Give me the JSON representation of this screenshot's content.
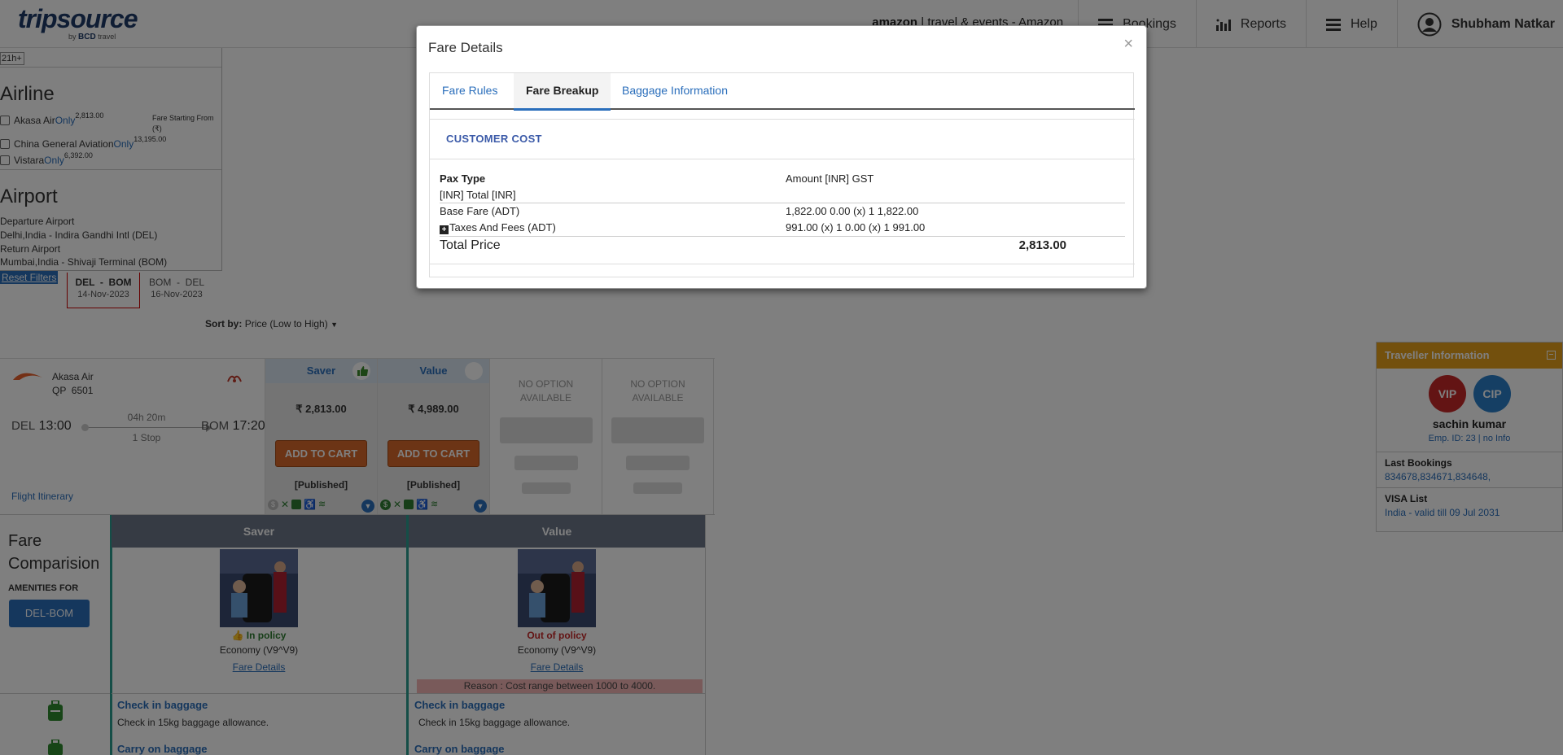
{
  "header": {
    "logo_main": "tripsource",
    "logo_sub_by": "by",
    "logo_sub_brand": "BCD",
    "logo_sub_tail": "travel",
    "account_bold": "amazon",
    "account_rest": " | travel & events - Amazon",
    "nav": [
      {
        "label": "Bookings",
        "icon": "bookings-icon"
      },
      {
        "label": "Reports",
        "icon": "reports-icon"
      },
      {
        "label": "Help",
        "icon": "help-icon"
      }
    ],
    "user_name": "Shubham Natkar"
  },
  "filters": {
    "time_chip": "21h+",
    "airline_heading": "Airline",
    "fare_starting_label": "Fare Starting From (₹)",
    "airlines": [
      {
        "name": "Akasa Air",
        "only": "Only",
        "price": "2,813.00"
      },
      {
        "name": "China General Aviation",
        "only": "Only",
        "price": "13,195.00"
      },
      {
        "name": "Vistara",
        "only": "Only",
        "price": "6,392.00"
      }
    ],
    "airport_heading": "Airport",
    "departure_label": "Departure Airport",
    "departure_value": "Delhi,India - Indira Gandhi Intl (DEL)",
    "return_label": "Return Airport",
    "return_value": "Mumbai,India - Shivaji Terminal (BOM)",
    "reset_label": "Reset Filters"
  },
  "legs": [
    {
      "route": "DEL  -  BOM",
      "date": "14-Nov-2023"
    },
    {
      "route": "BOM  -  DEL",
      "date": "16-Nov-2023"
    }
  ],
  "sort": {
    "label": "Sort by:",
    "value": "Price (Low to High)"
  },
  "flight": {
    "airline": "Akasa Air",
    "flight_no": "QP  6501",
    "from_code": "DEL",
    "dep_time": "13:00",
    "to_code": "BOM",
    "arr_time": "17:20",
    "duration": "04h 20m",
    "stops": "1 Stop",
    "itinerary_link": "Flight Itinerary",
    "fares": [
      {
        "name": "Saver",
        "price": "₹ 2,813.00",
        "button": "ADD TO CART",
        "tag": "[Published]"
      },
      {
        "name": "Value",
        "price": "₹ 4,989.00",
        "button": "ADD TO CART",
        "tag": "[Published]"
      }
    ],
    "no_option_text": "NO OPTION AVAILABLE"
  },
  "fare_comparison": {
    "title": "Fare Comparision",
    "amenities_label": "AMENITIES FOR",
    "route_button": "DEL-BOM",
    "columns": [
      {
        "name": "Saver",
        "policy": "In policy",
        "cabin": "Economy (V9^V9)",
        "details_link": "Fare Details",
        "reason": ""
      },
      {
        "name": "Value",
        "policy": "Out of policy",
        "cabin": "Economy (V9^V9)",
        "details_link": "Fare Details",
        "reason": "Reason : Cost range between 1000 to 4000."
      }
    ],
    "checkin_heading": "Check in baggage",
    "checkin_text": "Check in 15kg baggage allowance.",
    "carryon_heading": "Carry on baggage"
  },
  "traveller": {
    "heading": "Traveller Information",
    "badges": [
      "VIP",
      "CIP"
    ],
    "name": "sachin kumar",
    "emp": "Emp. ID: 23 | no Info",
    "last_bookings_label": "Last Bookings",
    "last_bookings_value": "834678,834671,834648,",
    "visa_label": "VISA List",
    "visa_value": "India - valid till 09 Jul 2031"
  },
  "modal": {
    "title": "Fare Details",
    "close": "×",
    "tabs": [
      "Fare Rules",
      "Fare Breakup",
      "Baggage Information"
    ],
    "active_tab": "Fare Breakup",
    "section_title": "CUSTOMER COST",
    "head_left": "Pax Type",
    "head_right": "Amount [INR] GST",
    "head_sub": "[INR] Total [INR]",
    "rows": [
      {
        "label": "Base Fare (ADT)",
        "value": "1,822.00 0.00 (x) 1 1,822.00"
      },
      {
        "label": "Taxes And Fees (ADT)",
        "value": "991.00 (x) 1 0.00 (x) 1 991.00"
      }
    ],
    "total_label": "Total Price",
    "total_value": "2,813.00"
  },
  "colors": {
    "brand_blue": "#2a6ebb",
    "cart_orange": "#d9692a",
    "traveller_header": "#e7a11b",
    "in_policy": "#2e7d32",
    "out_policy": "#c62828"
  }
}
